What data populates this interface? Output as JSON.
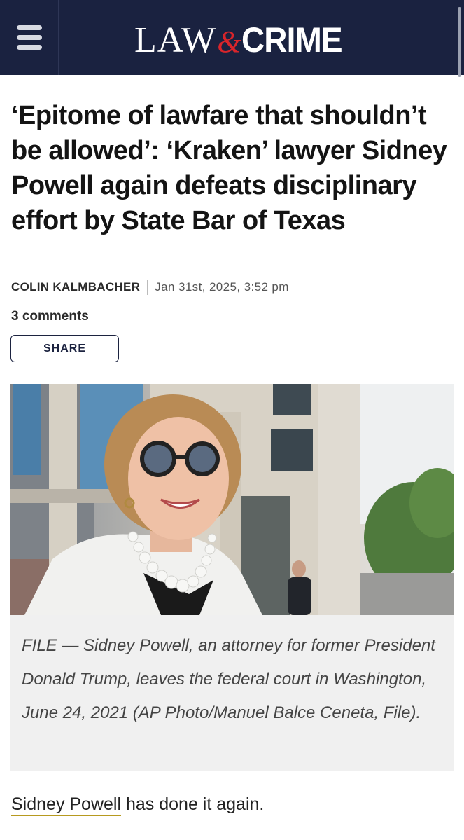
{
  "header": {
    "menu_icon": "hamburger-menu-icon",
    "logo": {
      "law": "LAW",
      "amp": "&",
      "crime": "CRIME"
    },
    "colors": {
      "background": "#1a2240",
      "accent": "#d8252b"
    }
  },
  "article": {
    "headline": "‘Epitome of lawfare that shouldn’t be allowed’: ‘Kraken’ lawyer Sidney Powell again defeats disciplinary effort by State Bar of Texas",
    "author": "COLIN KALMBACHER",
    "date": "Jan 31st, 2025, 3:52 pm",
    "comments": "3 comments",
    "share_label": "SHARE",
    "image_caption": "FILE — Sidney Powell, an attorney for former President Donald Trump, leaves the federal court in Washington, June 24, 2021 (AP Photo/Manuel Balce Ceneta, File).",
    "body_link": "Sidney Powell",
    "body_rest": " has done it again."
  }
}
